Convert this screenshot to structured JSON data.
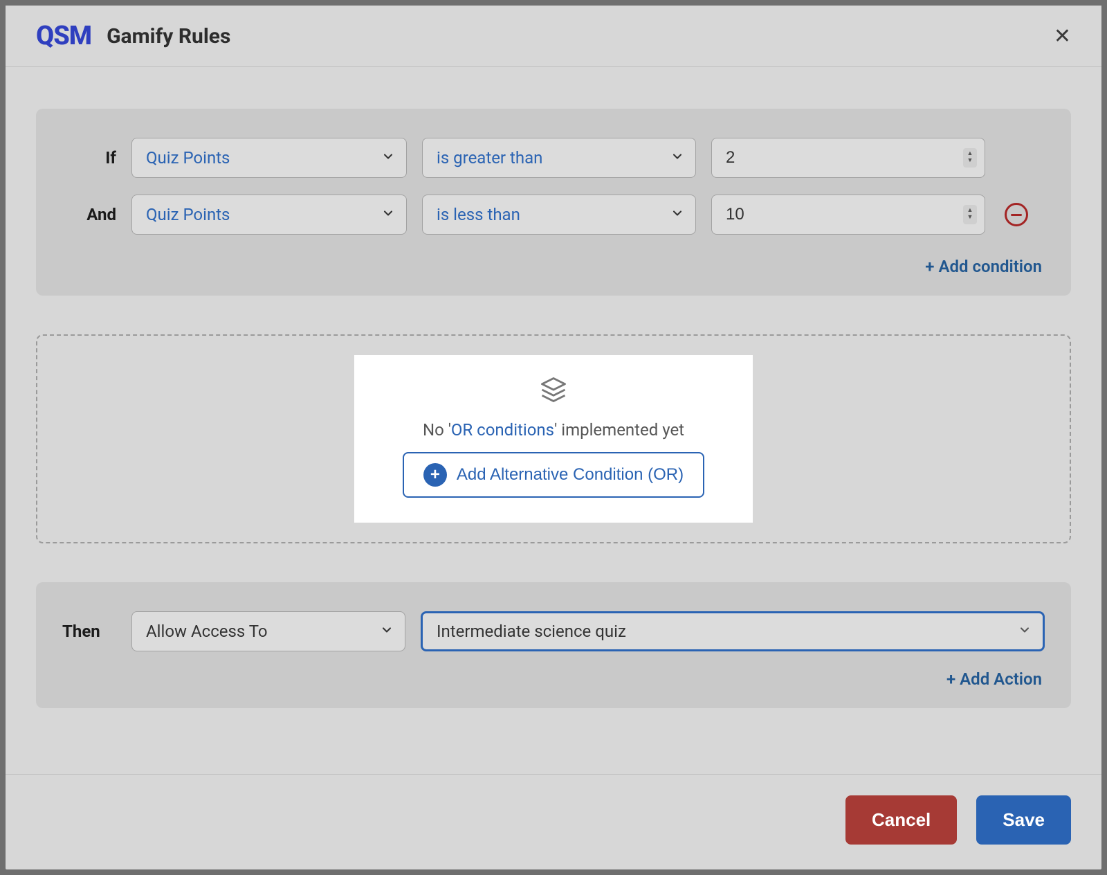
{
  "header": {
    "logo_text": "QSM",
    "title": "Gamify Rules"
  },
  "conditions": {
    "rows": [
      {
        "prefix": "If",
        "field": "Quiz Points",
        "operator": "is greater than",
        "value": "2",
        "removable": false
      },
      {
        "prefix": "And",
        "field": "Quiz Points",
        "operator": "is less than",
        "value": "10",
        "removable": true
      }
    ],
    "add_label": "+ Add condition"
  },
  "or_block": {
    "text_pre": "No '",
    "text_hl": "OR conditions",
    "text_post": "' implemented yet",
    "button_label": "Add Alternative Condition (OR)"
  },
  "then": {
    "prefix": "Then",
    "action": "Allow Access To",
    "target": "Intermediate science quiz",
    "add_label": "+ Add Action"
  },
  "footer": {
    "cancel": "Cancel",
    "save": "Save"
  }
}
